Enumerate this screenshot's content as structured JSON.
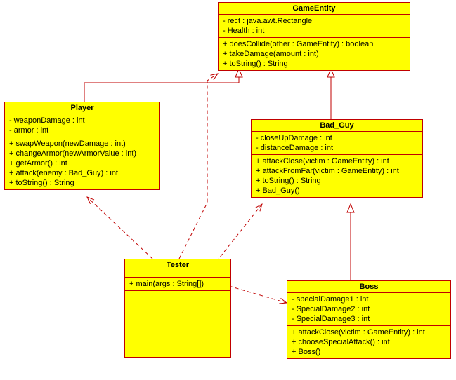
{
  "colors": {
    "box_fill": "#ffff00",
    "box_stroke": "#c00000"
  },
  "classes": {
    "GameEntity": {
      "name": "GameEntity",
      "attrs": [
        "- rect : java.awt.Rectangle",
        "- Health : int"
      ],
      "ops": [
        "+ doesCollide(other : GameEntity) : boolean",
        "+ takeDamage(amount : int)",
        "+ toString() : String"
      ]
    },
    "Player": {
      "name": "Player",
      "attrs": [
        "- weaponDamage : int",
        "- armor : int"
      ],
      "ops": [
        "+ swapWeapon(newDamage : int)",
        "+ changeArmor(newArmorValue : int)",
        "+ getArmor() : int",
        "+ attack(enemy : Bad_Guy) : int",
        "+ toString() : String"
      ]
    },
    "Bad_Guy": {
      "name": "Bad_Guy",
      "attrs": [
        "- closeUpDamage : int",
        "- distanceDamage : int"
      ],
      "ops": [
        "+ attackClose(victim : GameEntity) : int",
        "+ attackFromFar(victim : GameEntity) : int",
        "+ toString() : String",
        "+ Bad_Guy()"
      ]
    },
    "Tester": {
      "name": "Tester",
      "attrs": [],
      "ops": [
        "+ main(args : String[])"
      ]
    },
    "Boss": {
      "name": "Boss",
      "attrs": [
        "- specialDamage1 : int",
        "- SpecialDamage2 : int",
        "- SpecialDamage3 : int"
      ],
      "ops": [
        "+ attackClose(victim : GameEntity) : int",
        "+ chooseSpecialAttack() : int",
        "+ Boss()"
      ]
    }
  },
  "edges": [
    {
      "from": "Player",
      "to": "GameEntity",
      "type": "generalization"
    },
    {
      "from": "Bad_Guy",
      "to": "GameEntity",
      "type": "generalization"
    },
    {
      "from": "Boss",
      "to": "Bad_Guy",
      "type": "generalization"
    },
    {
      "from": "Tester",
      "to": "Player",
      "type": "dependency"
    },
    {
      "from": "Tester",
      "to": "GameEntity",
      "type": "dependency"
    },
    {
      "from": "Tester",
      "to": "Bad_Guy",
      "type": "dependency"
    },
    {
      "from": "Tester",
      "to": "Boss",
      "type": "dependency"
    }
  ]
}
